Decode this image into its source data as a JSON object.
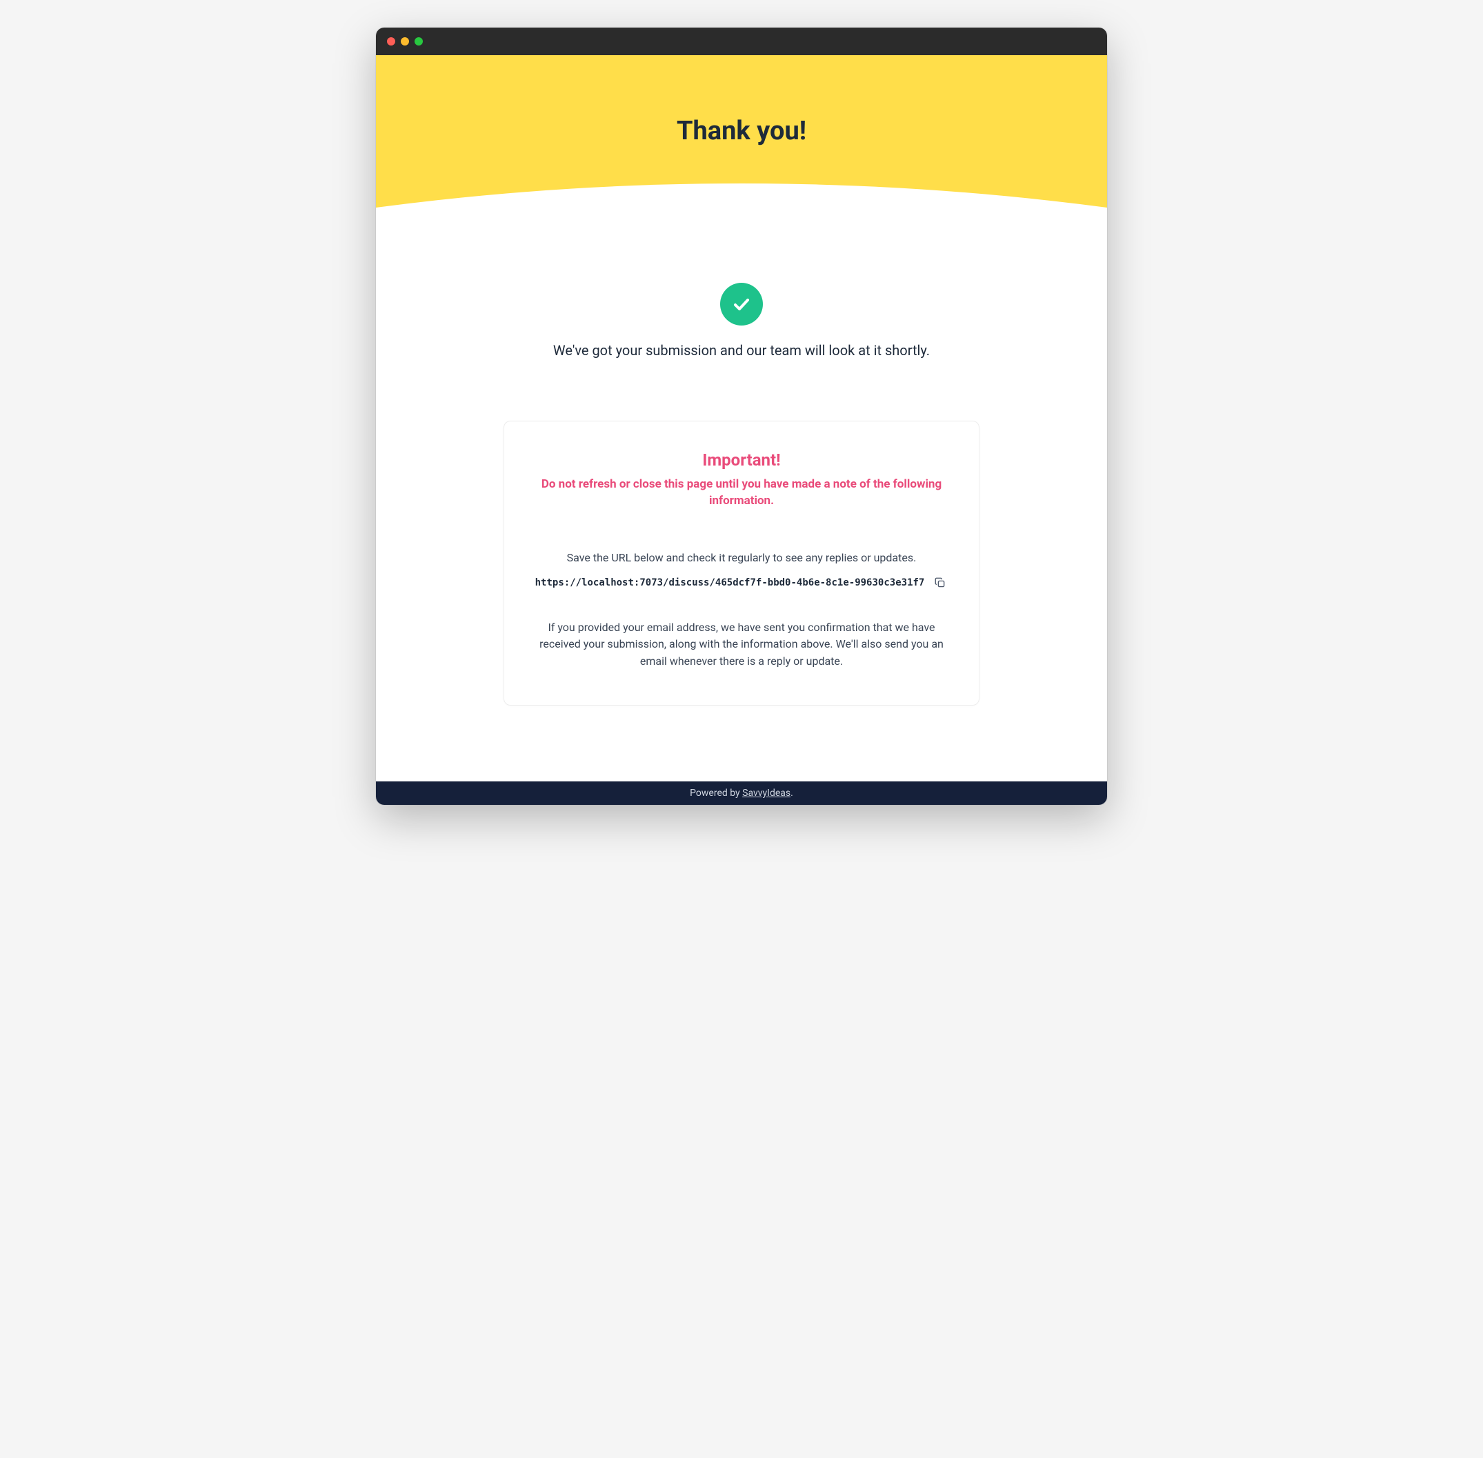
{
  "hero": {
    "title": "Thank you!"
  },
  "confirmation": {
    "message": "We've got your submission and our team will look at it shortly."
  },
  "card": {
    "heading": "Important!",
    "warning": "Do not refresh or close this page until you have made a note of the following information.",
    "instruction": "Save the URL below and check it regularly to see any replies or updates.",
    "url": "https://localhost:7073/discuss/465dcf7f-bbd0-4b6e-8c1e-99630c3e31f7",
    "email_note": "If you provided your email address, we have sent you confirmation that we have received your submission, along with the information above. We'll also send you an email whenever there is a reply or update."
  },
  "footer": {
    "prefix": "Powered by ",
    "link_text": "SavvyIdeas",
    "suffix": "."
  },
  "colors": {
    "accent_yellow": "#ffde4a",
    "success_green": "#1ec28b",
    "warning_pink": "#e94b7a",
    "footer_navy": "#15203a"
  }
}
